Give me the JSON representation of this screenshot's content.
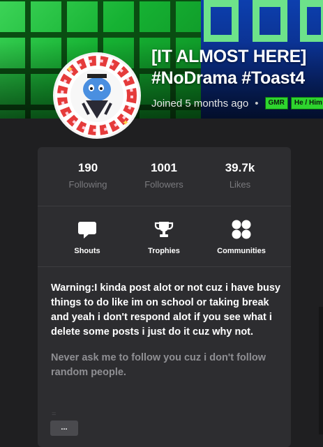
{
  "profile": {
    "title_line1": "[IT ALMOST HERE]",
    "title_line2": "#NoDrama #Toast4",
    "joined": "Joined 5 months ago",
    "dot": "•",
    "badges": [
      "GMR",
      "He / Him"
    ]
  },
  "stats": [
    {
      "value": "190",
      "label": "Following"
    },
    {
      "value": "1001",
      "label": "Followers"
    },
    {
      "value": "39.7k",
      "label": "Likes"
    }
  ],
  "actions": [
    {
      "label": "Shouts",
      "icon": "speech-bubble-icon"
    },
    {
      "label": "Trophies",
      "icon": "trophy-icon"
    },
    {
      "label": "Communities",
      "icon": "communities-icon"
    }
  ],
  "bio": {
    "paragraph1": "Warning:I kinda post alot or not cuz i have busy things to do like im on school or taking break and yeah i don't respond alot if you see what i delete some posts i just do it cuz why not.",
    "paragraph2": "Never ask me to follow you cuz i don't follow random people.",
    "tiny_mark": "=",
    "more_label": "..."
  },
  "colors": {
    "background": "#1f1f21",
    "card": "#2d2d30",
    "badge_green": "#2ed52e",
    "banner_green": "#16b233",
    "muted_text": "#8f8f93"
  }
}
